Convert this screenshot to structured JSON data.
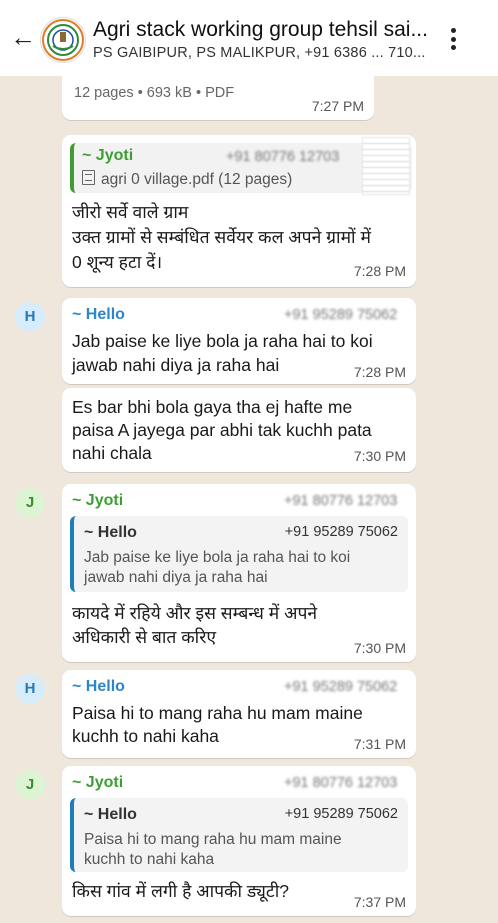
{
  "header": {
    "back": "←",
    "title": "Agri stack working group tehsil sai...",
    "subtitle": "PS GAIBIPUR, PS MALIKPUR, +91 6386 ... 710..."
  },
  "messages": {
    "m0": {
      "meta": "12 pages • 693 kB • PDF",
      "time": "7:27 PM"
    },
    "m1": {
      "sender": "~ Jyoti",
      "phone": "+91 80776 12703",
      "doc": "agri 0 village.pdf (12 pages)",
      "text1": "जीरो सर्वे वाले ग्राम",
      "text2": "उक्त ग्रामों से सम्बंधित सर्वेयर कल अपने ग्रामों में",
      "text3": "0 शून्य हटा दें।",
      "time": "7:28 PM"
    },
    "m2": {
      "avatar": "H",
      "sender": "~ Hello",
      "phone": "+91 95289 75062",
      "text1": "Jab paise ke liye bola ja raha hai to koi",
      "text2": "jawab nahi diya ja raha hai",
      "time": "7:28 PM"
    },
    "m3": {
      "text1": "Es bar bhi bola gaya tha ej hafte me",
      "text2": "paisa A jayega par abhi tak kuchh pata",
      "text3": "nahi chala",
      "time": "7:30 PM"
    },
    "m4": {
      "avatar": "J",
      "sender": "~ Jyoti",
      "phone": "+91 80776 12703",
      "quote_name": "~ Hello",
      "quote_phone": "+91 95289 75062",
      "quote_text1": "Jab paise ke liye bola ja raha hai to koi",
      "quote_text2": "jawab nahi diya ja raha hai",
      "text1": "कायदे में रहिये और इस सम्बन्ध में अपने",
      "text2": "अधिकारी से बात करिए",
      "time": "7:30 PM"
    },
    "m5": {
      "avatar": "H",
      "sender": "~ Hello",
      "phone": "+91 95289 75062",
      "text1": "Paisa hi to mang raha hu mam maine",
      "text2": "kuchh to nahi kaha",
      "time": "7:31 PM"
    },
    "m6": {
      "avatar": "J",
      "sender": "~ Jyoti",
      "phone": "+91 80776 12703",
      "quote_name": "~ Hello",
      "quote_phone": "+91 95289 75062",
      "quote_text1": "Paisa hi to mang raha hu mam maine",
      "quote_text2": "kuchh to nahi kaha",
      "text1": "किस गांव में लगी है आपकी ड्यूटी?",
      "time": "7:37 PM"
    }
  },
  "colors": {
    "hello_name": "#2e86c9",
    "jyoti_name": "#3e9e35",
    "quote_bar": "#1c7db8",
    "chat_bg": "#efe7dc"
  }
}
